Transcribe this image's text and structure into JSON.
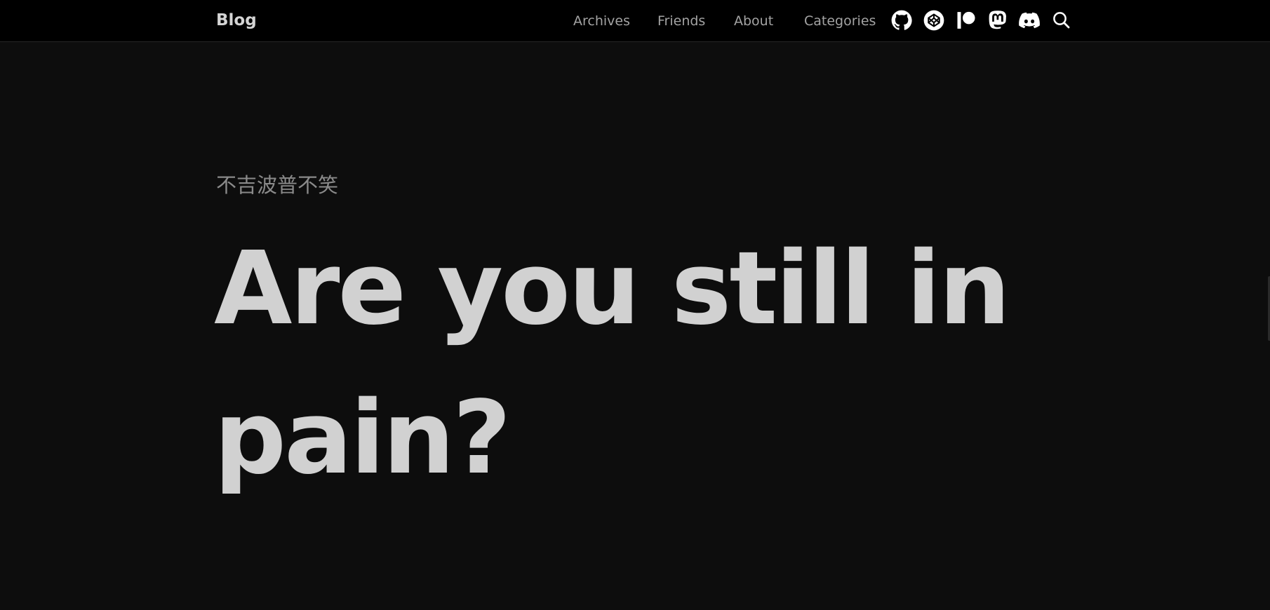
{
  "navbar": {
    "brand": "Blog",
    "links": [
      {
        "label": "Archives"
      },
      {
        "label": "Friends"
      },
      {
        "label": "About"
      },
      {
        "label": "Categories"
      }
    ],
    "icons": [
      "github-icon",
      "codepen-icon",
      "patreon-icon",
      "mastodon-icon",
      "discord-icon",
      "search-icon"
    ]
  },
  "hero": {
    "subtitle": "不吉波普不笑",
    "title": "Are you still in pain?"
  },
  "colors": {
    "background": "#0d0d0d",
    "navbar": "#000000",
    "title": "#d1d1d1",
    "subtitle": "#8a8a8a",
    "nav_link": "#a3a3a3",
    "icon": "#ffffff"
  }
}
